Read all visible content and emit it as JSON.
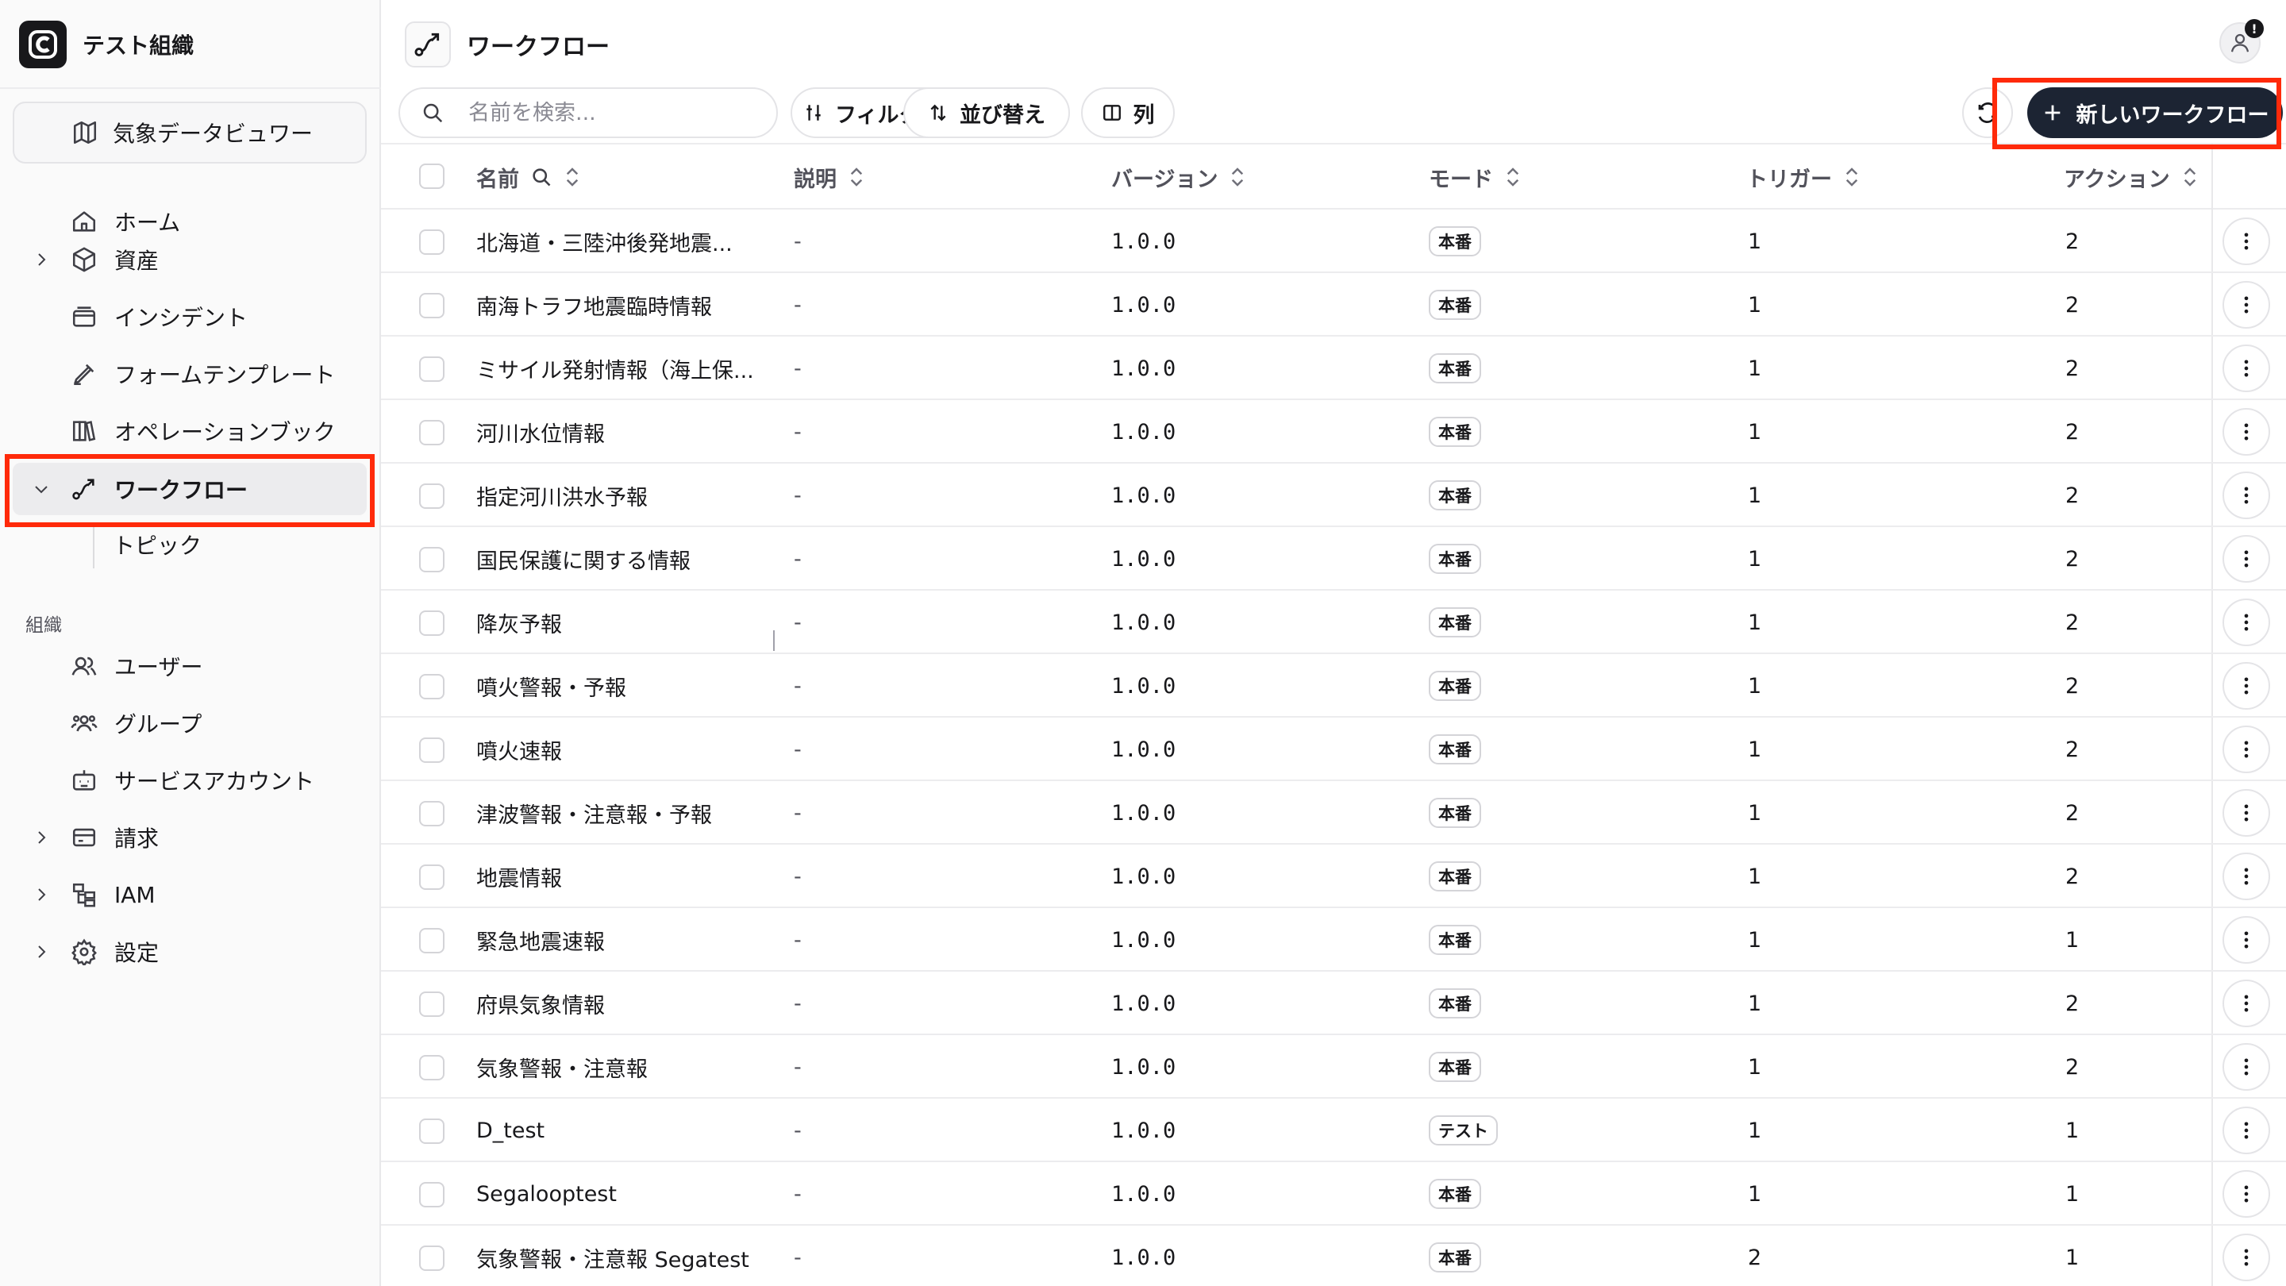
{
  "org": {
    "name": "テスト組織"
  },
  "sidebar": {
    "project_label": "気象データビュワー",
    "nav_items": [
      {
        "label": "ホーム",
        "icon": "home-icon"
      },
      {
        "label": "資産",
        "icon": "box-icon",
        "expandable": true
      },
      {
        "label": "インシデント",
        "icon": "incident-icon"
      },
      {
        "label": "フォームテンプレート",
        "icon": "form-template-icon"
      },
      {
        "label": "オペレーションブック",
        "icon": "book-icon"
      },
      {
        "label": "ワークフロー",
        "icon": "workflow-icon",
        "expanded": true,
        "active": true
      }
    ],
    "sub_items": [
      {
        "label": "トピック"
      }
    ],
    "section_label": "組織",
    "org_items": [
      {
        "label": "ユーザー",
        "icon": "users-icon"
      },
      {
        "label": "グループ",
        "icon": "group-icon"
      },
      {
        "label": "サービスアカウント",
        "icon": "bot-icon"
      },
      {
        "label": "請求",
        "icon": "billing-icon",
        "expandable": true
      },
      {
        "label": "IAM",
        "icon": "iam-icon",
        "expandable": true
      },
      {
        "label": "設定",
        "icon": "gear-icon",
        "expandable": true
      }
    ]
  },
  "header": {
    "title": "ワークフロー",
    "avatar_badge": "!"
  },
  "toolbar": {
    "search_placeholder": "名前を検索...",
    "filter_label": "フィルター",
    "sort_label": "並び替え",
    "columns_label": "列",
    "new_button_label": "新しいワークフロー"
  },
  "table": {
    "columns": [
      "名前",
      "説明",
      "バージョン",
      "モード",
      "トリガー",
      "アクション"
    ],
    "rows": [
      {
        "name": "北海道・三陸沖後発地震...",
        "description": "-",
        "version": "1.0.0",
        "mode": "本番",
        "triggers": "1",
        "actions": "2"
      },
      {
        "name": "南海トラフ地震臨時情報",
        "description": "-",
        "version": "1.0.0",
        "mode": "本番",
        "triggers": "1",
        "actions": "2"
      },
      {
        "name": "ミサイル発射情報（海上保...",
        "description": "-",
        "version": "1.0.0",
        "mode": "本番",
        "triggers": "1",
        "actions": "2"
      },
      {
        "name": "河川水位情報",
        "description": "-",
        "version": "1.0.0",
        "mode": "本番",
        "triggers": "1",
        "actions": "2"
      },
      {
        "name": "指定河川洪水予報",
        "description": "-",
        "version": "1.0.0",
        "mode": "本番",
        "triggers": "1",
        "actions": "2"
      },
      {
        "name": "国民保護に関する情報",
        "description": "-",
        "version": "1.0.0",
        "mode": "本番",
        "triggers": "1",
        "actions": "2"
      },
      {
        "name": "降灰予報",
        "description": "-",
        "version": "1.0.0",
        "mode": "本番",
        "triggers": "1",
        "actions": "2"
      },
      {
        "name": "噴火警報・予報",
        "description": "-",
        "version": "1.0.0",
        "mode": "本番",
        "triggers": "1",
        "actions": "2"
      },
      {
        "name": "噴火速報",
        "description": "-",
        "version": "1.0.0",
        "mode": "本番",
        "triggers": "1",
        "actions": "2"
      },
      {
        "name": "津波警報・注意報・予報",
        "description": "-",
        "version": "1.0.0",
        "mode": "本番",
        "triggers": "1",
        "actions": "2"
      },
      {
        "name": "地震情報",
        "description": "-",
        "version": "1.0.0",
        "mode": "本番",
        "triggers": "1",
        "actions": "2"
      },
      {
        "name": "緊急地震速報",
        "description": "-",
        "version": "1.0.0",
        "mode": "本番",
        "triggers": "1",
        "actions": "1"
      },
      {
        "name": "府県気象情報",
        "description": "-",
        "version": "1.0.0",
        "mode": "本番",
        "triggers": "1",
        "actions": "2"
      },
      {
        "name": "気象警報・注意報",
        "description": "-",
        "version": "1.0.0",
        "mode": "本番",
        "triggers": "1",
        "actions": "2"
      },
      {
        "name": "D_test",
        "description": "-",
        "version": "1.0.0",
        "mode": "テスト",
        "triggers": "1",
        "actions": "1"
      },
      {
        "name": "Segalooptest",
        "description": "-",
        "version": "1.0.0",
        "mode": "本番",
        "triggers": "1",
        "actions": "1"
      },
      {
        "name": "気象警報・注意報 Segatest",
        "description": "-",
        "version": "1.0.0",
        "mode": "本番",
        "triggers": "2",
        "actions": "1"
      }
    ]
  },
  "colors": {
    "highlight": "#ff2a0a",
    "primary_button": "#1c2433",
    "active_nav": "#ececee"
  }
}
